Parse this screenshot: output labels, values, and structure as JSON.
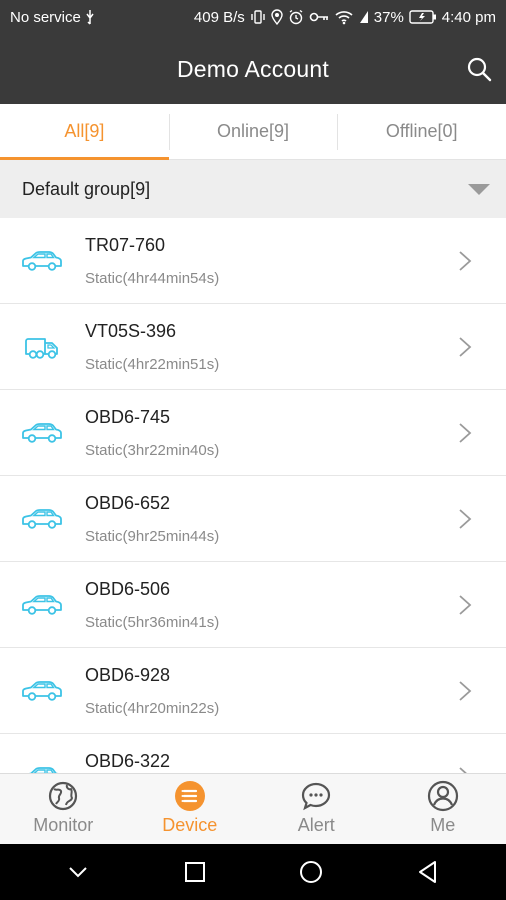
{
  "status_bar": {
    "carrier": "No service",
    "speed": "409 B/s",
    "battery": "37%",
    "time": "4:40 pm"
  },
  "header": {
    "title": "Demo Account"
  },
  "tabs": [
    {
      "label": "All[9]",
      "active": true
    },
    {
      "label": "Online[9]",
      "active": false
    },
    {
      "label": "Offline[0]",
      "active": false
    }
  ],
  "group": {
    "label": "Default group[9]"
  },
  "devices": [
    {
      "name": "TR07-760",
      "status": "Static(4hr44min54s)",
      "icon": "car-icon"
    },
    {
      "name": "VT05S-396",
      "status": "Static(4hr22min51s)",
      "icon": "truck-icon"
    },
    {
      "name": "OBD6-745",
      "status": "Static(3hr22min40s)",
      "icon": "car-icon"
    },
    {
      "name": "OBD6-652",
      "status": "Static(9hr25min44s)",
      "icon": "car-icon"
    },
    {
      "name": "OBD6-506",
      "status": "Static(5hr36min41s)",
      "icon": "car-icon"
    },
    {
      "name": "OBD6-928",
      "status": "Static(4hr20min22s)",
      "icon": "car-icon"
    },
    {
      "name": "OBD6-322",
      "status": "",
      "icon": "car-icon"
    }
  ],
  "bottom_nav": [
    {
      "label": "Monitor",
      "icon": "globe-icon",
      "active": false
    },
    {
      "label": "Device",
      "icon": "list-icon",
      "active": true
    },
    {
      "label": "Alert",
      "icon": "chat-bubble-icon",
      "active": false
    },
    {
      "label": "Me",
      "icon": "user-icon",
      "active": false
    }
  ],
  "colors": {
    "accent": "#f5932f",
    "header_bg": "#3a3a3a",
    "vehicle_icon": "#3cc3e6"
  }
}
